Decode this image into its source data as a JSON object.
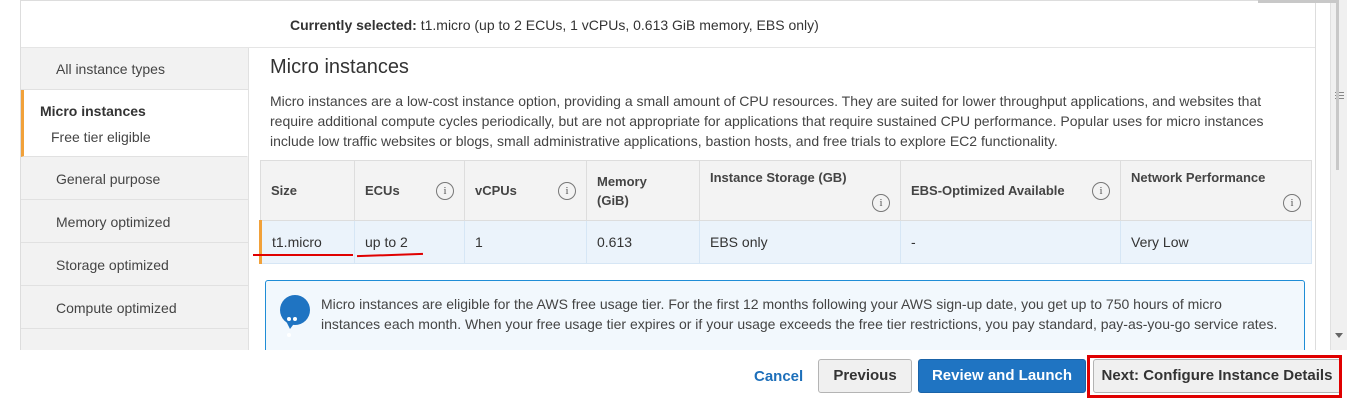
{
  "header": {
    "selected_label": "Currently selected:",
    "selected_value": "t1.micro (up to 2 ECUs, 1 vCPUs, 0.613 GiB memory, EBS only)"
  },
  "sidebar": {
    "items": [
      {
        "label": "All instance types"
      },
      {
        "label": "Micro instances",
        "sublabel": "Free tier eligible"
      },
      {
        "label": "General purpose"
      },
      {
        "label": "Memory optimized"
      },
      {
        "label": "Storage optimized"
      },
      {
        "label": "Compute optimized"
      }
    ]
  },
  "main": {
    "title": "Micro instances",
    "description": "Micro instances are a low-cost instance option, providing a small amount of CPU resources. They are suited for lower throughput applications, and websites that require additional compute cycles periodically, but are not appropriate for applications that require sustained CPU performance. Popular uses for micro instances include low traffic websites or blogs, small administrative applications, bastion hosts, and free trials to explore EC2 functionality."
  },
  "table": {
    "columns": [
      "Size",
      "ECUs",
      "vCPUs",
      "Memory (GiB)",
      "Instance Storage (GB)",
      "EBS-Optimized Available",
      "Network Performance"
    ],
    "info_glyph": "i",
    "rows": [
      [
        "t1.micro",
        "up to 2",
        "1",
        "0.613",
        "EBS only",
        "-",
        "Very Low"
      ]
    ]
  },
  "notice": {
    "text": "Micro instances are eligible for the AWS free usage tier. For the first 12 months following your AWS sign-up date, you get up to 750 hours of micro instances each month. When your free usage tier expires or if your usage exceeds the free tier restrictions, you pay standard, pay-as-you-go service rates.",
    "icon": "chat-bubble-icon"
  },
  "footer": {
    "cancel": "Cancel",
    "previous": "Previous",
    "review": "Review and Launch",
    "next": "Next: Configure Instance Details"
  },
  "colors": {
    "accent_orange": "#f1a13a",
    "primary_blue": "#1f74c2",
    "link_blue": "#1d6fba",
    "annotation_red": "#e00000",
    "selected_row": "#ebf3fb"
  }
}
